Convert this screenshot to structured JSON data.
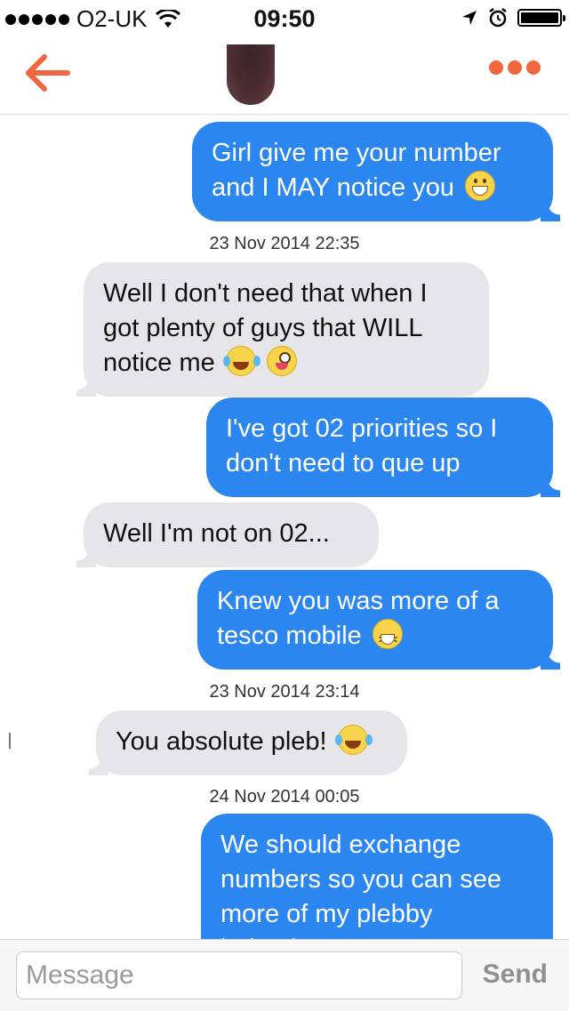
{
  "status_bar": {
    "signal_dots": 5,
    "carrier": "O2-UK",
    "time": "09:50",
    "battery_level": 1.0,
    "icons": [
      "wifi-icon",
      "location-arrow-icon",
      "alarm-icon",
      "battery-icon"
    ]
  },
  "nav": {
    "back_icon": "arrow-left-icon",
    "more_icon": "more-dots-icon",
    "accent_color": "#f0663f"
  },
  "colors": {
    "outgoing_bubble": "#2b87ef",
    "incoming_bubble": "#e6e6ea"
  },
  "messages": [
    {
      "dir": "out",
      "lines": [
        "Girl give me your number",
        "and I MAY notice you"
      ],
      "emoji": [
        "grinning-face-icon"
      ]
    },
    {
      "dir": "timestamp",
      "text": "23 Nov 2014 22:35"
    },
    {
      "dir": "in",
      "lines": [
        "Well I don't need that when I",
        "got plenty of guys that WILL",
        "notice me"
      ],
      "emoji": [
        "tears-of-joy-icon",
        "winking-tongue-icon"
      ]
    },
    {
      "dir": "out",
      "lines": [
        "I've got 02 priorities so I",
        "don't need to que up"
      ]
    },
    {
      "dir": "in",
      "lines": [
        "Well I'm not on 02..."
      ]
    },
    {
      "dir": "out",
      "lines": [
        "Knew you was more of a",
        "tesco mobile"
      ],
      "emoji": [
        "laughing-face-icon"
      ]
    },
    {
      "dir": "timestamp",
      "text": "23 Nov 2014 23:14"
    },
    {
      "dir": "in",
      "lines": [
        "You absolute pleb!"
      ],
      "emoji": [
        "tears-of-joy-icon"
      ]
    },
    {
      "dir": "timestamp",
      "text": "24 Nov 2014 00:05"
    },
    {
      "dir": "out",
      "lines": [
        "We should exchange",
        "numbers so you can see",
        "more of my plebby",
        "behaviour"
      ]
    }
  ],
  "composer": {
    "placeholder": "Message",
    "value": "",
    "send_label": "Send"
  }
}
